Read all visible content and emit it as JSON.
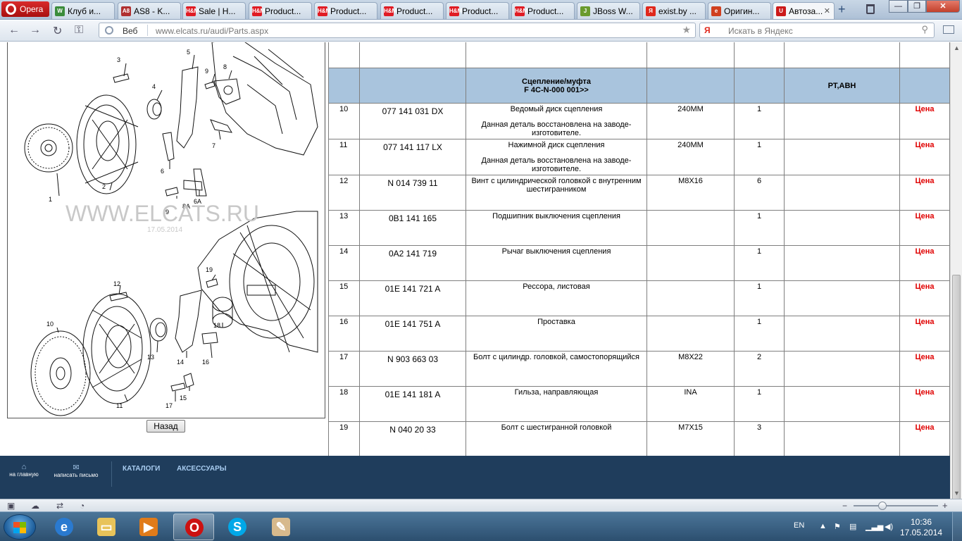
{
  "browser": {
    "menu_label": "Opera",
    "tabs": [
      {
        "title": "Клуб и...",
        "fav": "W",
        "fav_color": "#3b8c3b"
      },
      {
        "title": "AS8 - K...",
        "fav": "A8",
        "fav_color": "#b03030"
      },
      {
        "title": "Sale | H...",
        "fav": "H&M",
        "fav_color": "#e01c24"
      },
      {
        "title": "Product...",
        "fav": "H&M",
        "fav_color": "#e01c24"
      },
      {
        "title": "Product...",
        "fav": "H&M",
        "fav_color": "#e01c24"
      },
      {
        "title": "Product...",
        "fav": "H&M",
        "fav_color": "#e01c24"
      },
      {
        "title": "Product...",
        "fav": "H&M",
        "fav_color": "#e01c24"
      },
      {
        "title": "Product...",
        "fav": "H&M",
        "fav_color": "#e01c24"
      },
      {
        "title": "JBoss W...",
        "fav": "J",
        "fav_color": "#6a9b2e"
      },
      {
        "title": "exist.by ...",
        "fav": "Я",
        "fav_color": "#e0281c"
      },
      {
        "title": "Оригин...",
        "fav": "e",
        "fav_color": "#d04020"
      },
      {
        "title": "Автоза...",
        "fav": "U",
        "fav_color": "#cc1a1a",
        "active": true
      }
    ],
    "address": {
      "label": "Веб",
      "url": "www.elcats.ru/audi/Parts.aspx"
    },
    "search": {
      "engine": "Я",
      "placeholder": "Искать в Яндекс"
    }
  },
  "diagram": {
    "watermark": "WWW.ELCATS.RU",
    "watermark_date": "17.05.2014",
    "callouts": [
      "1",
      "2",
      "3",
      "4",
      "5",
      "6",
      "6A",
      "7",
      "8",
      "8A",
      "9",
      "9",
      "10",
      "11",
      "12",
      "13",
      "14",
      "15",
      "16",
      "17",
      "18",
      "19"
    ],
    "back_button": "Назад"
  },
  "table": {
    "top_row": {
      "num": "",
      "code": "",
      "name": "",
      "size": "",
      "qty": "",
      "note": "",
      "price": ""
    },
    "group": {
      "title": "Сцепление/муфта",
      "subtitle": "F 4C-N-000 001>>",
      "note": "РТ,АВН"
    },
    "rows": [
      {
        "num": "10",
        "code": "077 141 031 DX",
        "name": "Ведомый диск сцепления",
        "note": "Данная деталь восстановлена на заводе-изготовителе.",
        "size": "240MM",
        "qty": "1",
        "price": "Цена"
      },
      {
        "num": "11",
        "code": "077 141 117 LX",
        "name": "Нажимной диск сцепления",
        "note": "Данная деталь восстановлена на заводе-изготовителе.",
        "size": "240MM",
        "qty": "1",
        "price": "Цена"
      },
      {
        "num": "12",
        "code": "N 014 739 11",
        "name": "Винт с цилиндрической головкой с внутренним шестигранником",
        "note": "",
        "size": "M8X16",
        "qty": "6",
        "price": "Цена"
      },
      {
        "num": "13",
        "code": "0B1 141 165",
        "name": "Подшипник выключения сцепления",
        "note": "",
        "size": "",
        "qty": "1",
        "price": "Цена"
      },
      {
        "num": "14",
        "code": "0A2 141 719",
        "name": "Рычаг выключения сцепления",
        "note": "",
        "size": "",
        "qty": "1",
        "price": "Цена"
      },
      {
        "num": "15",
        "code": "01E 141 721 A",
        "name": "Рессора, листовая",
        "note": "",
        "size": "",
        "qty": "1",
        "price": "Цена"
      },
      {
        "num": "16",
        "code": "01E 141 751 A",
        "name": "Проставка",
        "note": "",
        "size": "",
        "qty": "1",
        "price": "Цена"
      },
      {
        "num": "17",
        "code": "N 903 663 03",
        "name": "Болт с цилиндр. головкой, самостопорящийся",
        "note": "",
        "size": "M8X22",
        "qty": "2",
        "price": "Цена"
      },
      {
        "num": "18",
        "code": "01E 141 181 A",
        "name": "Гильза, направляющая",
        "note": "",
        "size": "INA",
        "qty": "1",
        "price": "Цена"
      },
      {
        "num": "19",
        "code": "N 040 20 33",
        "name": "Болт с шестигранной головкой",
        "note": "",
        "size": "M7X15",
        "qty": "3",
        "price": "Цена"
      }
    ]
  },
  "footer": {
    "home": "на главную",
    "write": "написать письмо",
    "menu": [
      "КАТАЛОГИ",
      "АКСЕССУАРЫ"
    ]
  },
  "taskbar": {
    "lang": "EN",
    "time": "10:36",
    "date": "17.05.2014"
  },
  "colors": {
    "group_row": "#a9c4dd",
    "price": "#e00000",
    "footer_bg": "#1f3d5c"
  }
}
